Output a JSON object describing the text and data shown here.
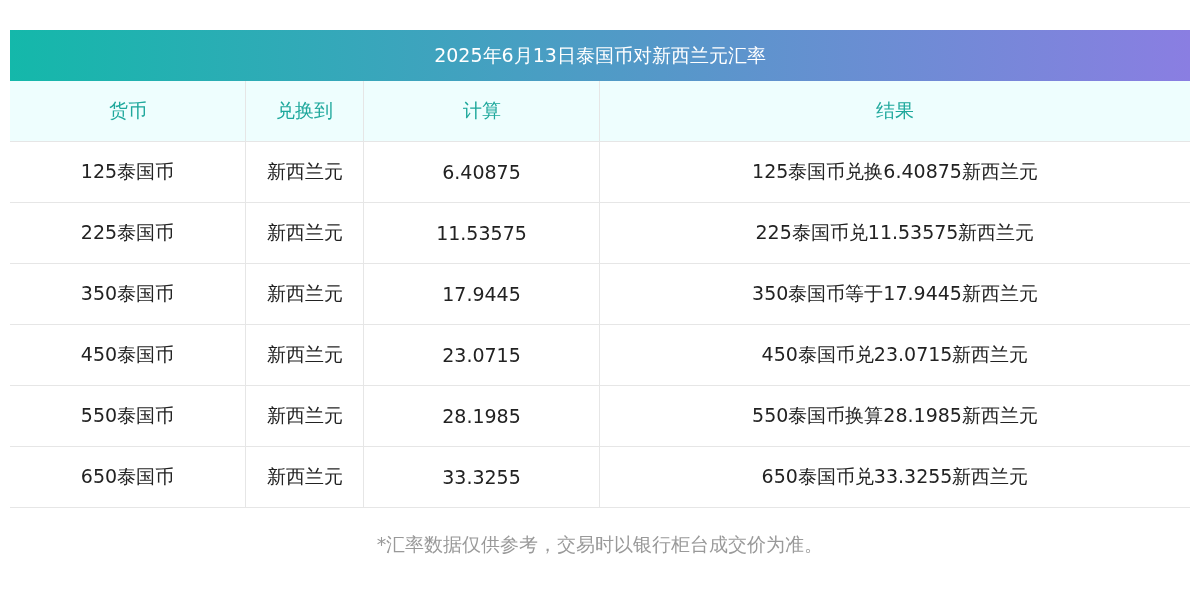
{
  "table": {
    "title": "2025年6月13日泰国币对新西兰元汇率",
    "columns": [
      "货币",
      "兑换到",
      "计算",
      "结果"
    ],
    "rows": [
      [
        "125泰国币",
        "新西兰元",
        "6.40875",
        "125泰国币兑换6.40875新西兰元"
      ],
      [
        "225泰国币",
        "新西兰元",
        "11.53575",
        "225泰国币兑11.53575新西兰元"
      ],
      [
        "350泰国币",
        "新西兰元",
        "17.9445",
        "350泰国币等于17.9445新西兰元"
      ],
      [
        "450泰国币",
        "新西兰元",
        "23.0715",
        "450泰国币兑23.0715新西兰元"
      ],
      [
        "550泰国币",
        "新西兰元",
        "28.1985",
        "550泰国币换算28.1985新西兰元"
      ],
      [
        "650泰国币",
        "新西兰元",
        "33.3255",
        "650泰国币兑33.3255新西兰元"
      ]
    ]
  },
  "footnote": "*汇率数据仅供参考，交易时以银行柜台成交价为准。"
}
